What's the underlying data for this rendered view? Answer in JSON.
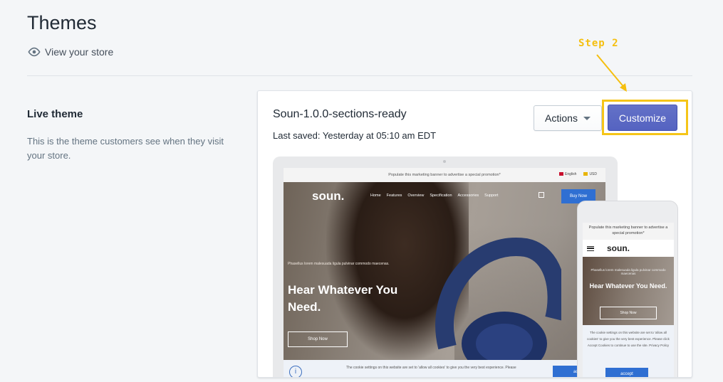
{
  "header": {
    "title": "Themes",
    "view_store_label": "View your store"
  },
  "live_theme": {
    "title": "Live theme",
    "description": "This is the theme customers see when they visit your store."
  },
  "theme_card": {
    "name": "Soun-1.0.0-sections-ready",
    "last_saved": "Last saved: Yesterday at 05:10 am EDT",
    "actions_label": "Actions",
    "customize_label": "Customize"
  },
  "annotation": {
    "step_label": "Step 2",
    "color": "#f5c518"
  },
  "desktop_preview": {
    "promo": "Populate this marketing banner to advertise a special promotion*",
    "language": "English",
    "currency": "USD",
    "logo": "soun.",
    "nav": [
      "Home",
      "Features",
      "Overview",
      "Specification",
      "Accessories",
      "Support"
    ],
    "cart_count": "0",
    "buy_now": "Buy Now",
    "hero_subtitle": "Phasellus lorem malesuada ligula pulvinar commodo maecenas.",
    "hero_title": "Hear Whatever You Need.",
    "shop_now": "Shop Now",
    "cookie_text": "The cookie settings on this website are set to 'allow all cookies' to give you the very best experience. Please",
    "accept": "accep"
  },
  "mobile_preview": {
    "promo": "Populate this marketing banner to advertise a special promotion*",
    "logo": "soun.",
    "cart_count": "0",
    "hero_subtitle": "Phasellus lorem malesuada ligula pulvinar commodo maecenas",
    "hero_title": "Hear Whatever You Need.",
    "shop_now": "Shop Now",
    "cookie_text": "The cookie settings on this website are set to 'allow all cookies' to give you the very best experience. Please click Accept Cookies to continue to use the site. Privacy Policy",
    "accept": "accept"
  },
  "colors": {
    "primary_button": "#5563c1",
    "background": "#f4f6f8",
    "site_blue": "#2f6fd2"
  }
}
